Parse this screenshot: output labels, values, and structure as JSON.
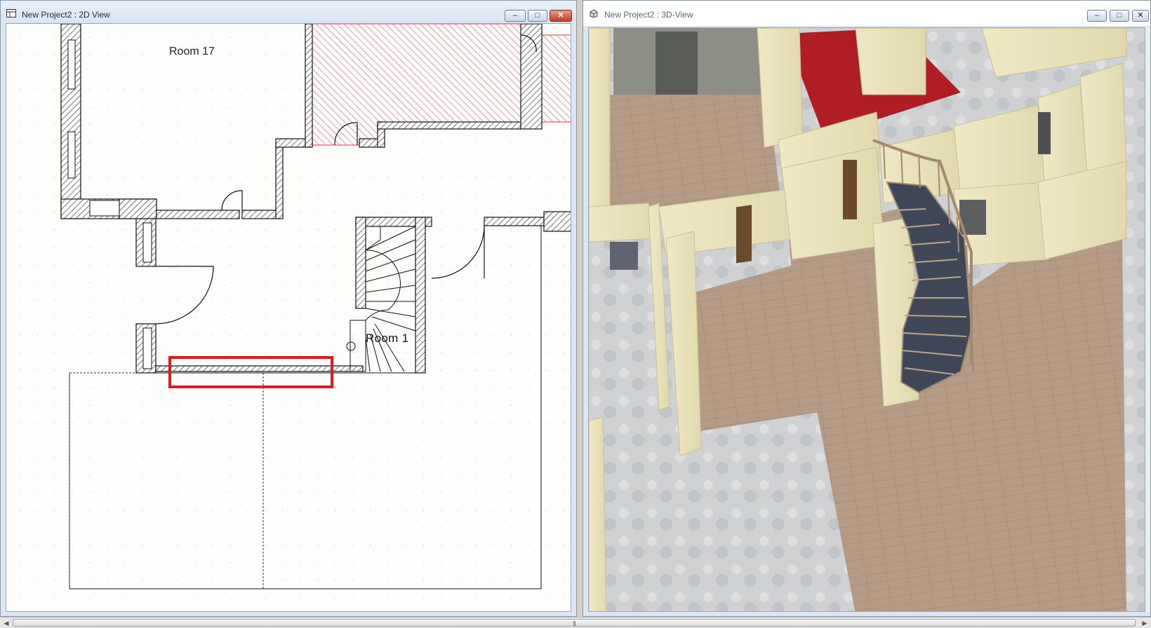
{
  "windows": {
    "view2d": {
      "title": "New Project2 : 2D View",
      "rooms": [
        "Room 17",
        "Room 1"
      ]
    },
    "view3d": {
      "title": "New Project2 : 3D-View"
    }
  },
  "controls": {
    "minimize": "–",
    "maximize": "□",
    "close": "✕"
  },
  "scrollbar": {
    "left_arrow": "◀",
    "right_arrow": "▶",
    "grip": "|||"
  },
  "colors": {
    "highlight": "#e8181a",
    "hatch_red": "#e43b3b",
    "floor": "#b59b86",
    "wall": "#eae3b8",
    "carpet": "#b01e24",
    "stair": "#3e4658"
  }
}
